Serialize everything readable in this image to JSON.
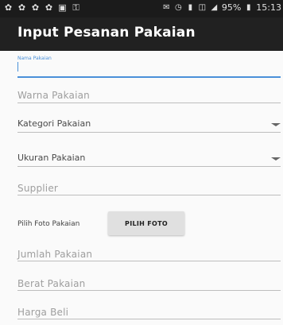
{
  "status_bar": {
    "battery": "95%",
    "time": "15:13",
    "left_icons": [
      "notification-icon",
      "notification-icon",
      "notification-icon",
      "notification-icon",
      "image-icon",
      "key-icon"
    ],
    "right_icons": [
      "sms-icon",
      "alarm-icon",
      "vibrate-icon",
      "signal-icon",
      "signal-bars-icon",
      "battery-icon"
    ]
  },
  "app_bar": {
    "title": "Input Pesanan Pakaian"
  },
  "form": {
    "nama": {
      "floating_label": "Nama Pakaian",
      "value": ""
    },
    "warna": {
      "placeholder": "Warna Pakaian"
    },
    "kategori": {
      "selected": "Kategori Pakaian"
    },
    "ukuran": {
      "selected": "Ukuran Pakaian"
    },
    "supplier": {
      "placeholder": "Supplier"
    },
    "foto": {
      "label": "Pilih Foto Pakaian",
      "button": "PILIH FOTO"
    },
    "jumlah": {
      "placeholder": "Jumlah Pakaian"
    },
    "berat": {
      "placeholder": "Berat Pakaian"
    },
    "harga": {
      "placeholder": "Harga Beli"
    }
  },
  "colors": {
    "accent": "#4a90d9",
    "app_bar": "#212121",
    "status_bar": "#1b1b1b"
  }
}
